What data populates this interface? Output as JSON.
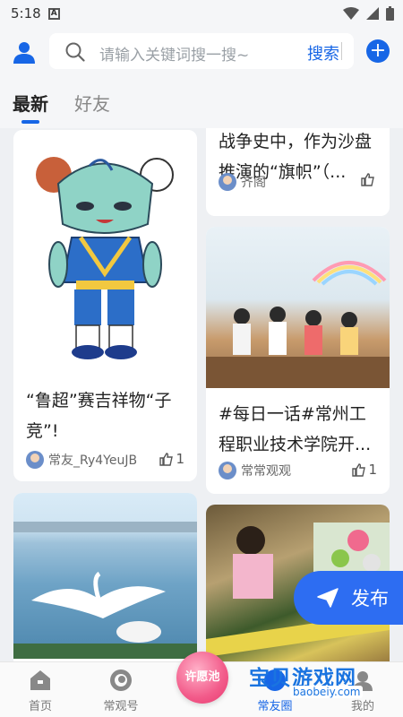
{
  "status": {
    "time": "5:18"
  },
  "search": {
    "placeholder": "请输入关键词搜一搜~",
    "button_label": "搜索"
  },
  "tabs": [
    {
      "label": "最新"
    },
    {
      "label": "好友"
    }
  ],
  "cards": [
    {
      "title": "“鲁超”赛吉祥物“子竞”!",
      "author": "常友_Ry4YeuJB",
      "likes": "1"
    },
    {
      "title": "战争史中，作为沙盘推演的“旗帜”（...",
      "author": "齐阁",
      "likes": ""
    },
    {
      "title": "#每日一话#常州工程职业技术学院开...",
      "author": "常常观观",
      "likes": "1"
    },
    {
      "title": "",
      "author": "",
      "likes": ""
    },
    {
      "title": "",
      "author": "",
      "likes": ""
    }
  ],
  "publish": {
    "label": "发布"
  },
  "nav": [
    {
      "label": "首页",
      "icon": "home-icon"
    },
    {
      "label": "常观号",
      "icon": "eye-icon"
    },
    {
      "label": "许愿池",
      "icon": "wish-icon"
    },
    {
      "label": "常友圈",
      "icon": "friends-icon"
    },
    {
      "label": "我的",
      "icon": "profile-icon"
    }
  ],
  "watermark": {
    "main": "宝贝游戏网",
    "sub": "baobeiy.com"
  },
  "colors": {
    "accent": "#1766e6",
    "publish": "#2d6df2",
    "wish": "#f25b8a"
  }
}
